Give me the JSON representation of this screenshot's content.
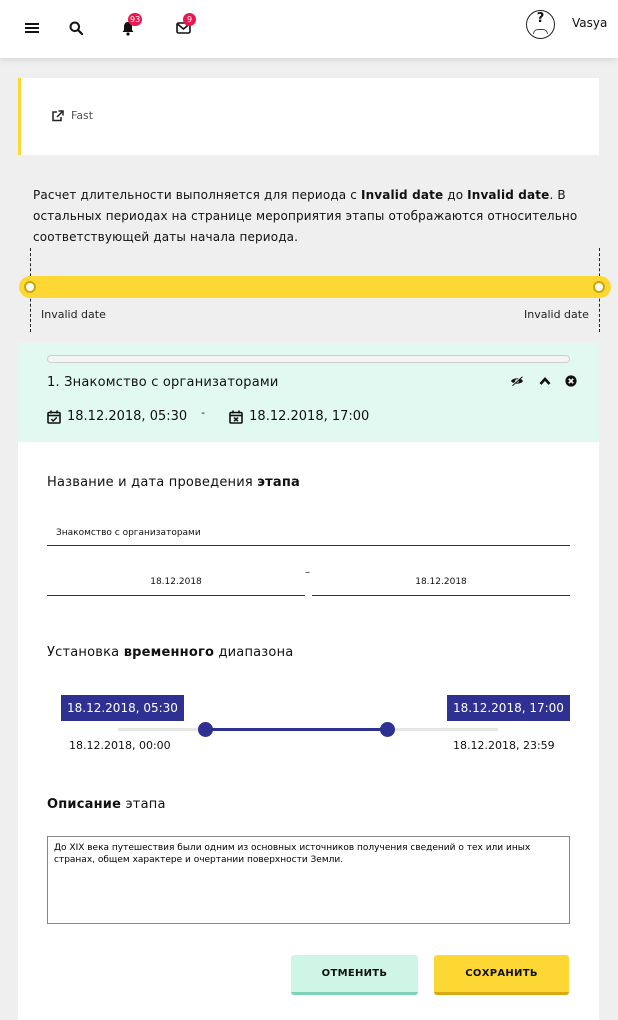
{
  "header": {
    "notifications_count": "93",
    "messages_count": "9",
    "username": "Vasya",
    "icons": [
      "menu-icon",
      "search-icon",
      "bell-icon",
      "mail-icon",
      "avatar"
    ]
  },
  "fast": {
    "label": "Fast",
    "icon": "external-link-icon"
  },
  "info": {
    "part1": "Расчет длительности выполняется для периода с ",
    "date_from": "Invalid date",
    "part2": " до ",
    "date_to": "Invalid date",
    "part3": ". В остальных периодах на странице мероприятия этапы отображаются относительно соответствующей даты начала периода."
  },
  "timeline": {
    "start_label": "Invalid date",
    "end_label": "Invalid date"
  },
  "stage": {
    "title": "1. Знакомство с организаторами",
    "start": "18.12.2018, 05:30",
    "separator": "-",
    "end": "18.12.2018, 17:00"
  },
  "form": {
    "name_section": {
      "prefix": "Название и дата проведения ",
      "bold": "этапа"
    },
    "name_value": "Знакомство с организаторами",
    "date_from": "18.12.2018",
    "date_sep": "–",
    "date_to": "18.12.2018",
    "range_section": {
      "prefix": "Установка ",
      "bold": "временного",
      "suffix": " диапазона"
    },
    "range": {
      "selected_start": "18.12.2018, 05:30",
      "selected_end": "18.12.2018, 17:00",
      "min_label": "18.12.2018, 00:00",
      "max_label": "18.12.2018, 23:59",
      "start_fraction": 0.229,
      "end_fraction": 0.708
    },
    "desc_section": {
      "bold": "Описание",
      "suffix": " этапа"
    },
    "description": "До XIX века путешествия были одним из основных источников получения сведений о тех или иных странах, общем характере и очертании поверхности Земли.",
    "cancel_label": "ОТМЕНИТЬ",
    "save_label": "СОХРАНИТЬ"
  },
  "colors": {
    "accent_yellow": "#fdd835",
    "accent_blue": "#2e3092",
    "mint": "#e2f9f1",
    "badge_red": "#e8174f"
  }
}
